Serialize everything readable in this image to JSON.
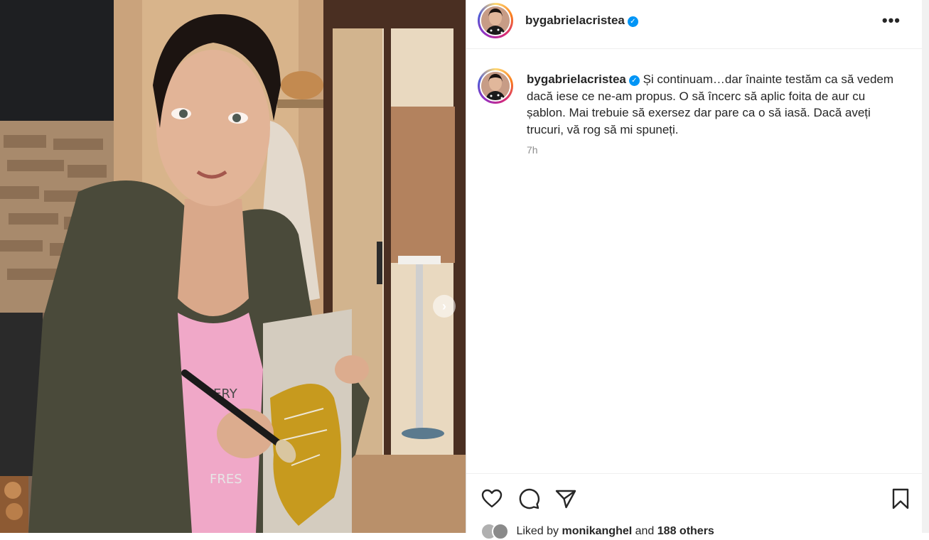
{
  "post": {
    "username": "bygabrielacristea",
    "caption": "Și continuam…dar înainte testăm ca să vedem dacă iese ce ne-am propus. O să încerc să aplic foita de aur cu șablon. Mai trebuie să exersez dar pare ca o să iasă. Dacă aveți trucuri, vă rog să mi spuneți.",
    "time_ago": "7h",
    "more_label": "•••"
  },
  "likes": {
    "prefix": "Liked by ",
    "user": "monikangheI",
    "connector": " and ",
    "others": "188 others"
  },
  "icons": {
    "like": "heart-icon",
    "comment": "comment-icon",
    "share": "send-icon",
    "save": "bookmark-icon",
    "verified": "verified-badge-icon",
    "next": "chevron-right-icon"
  },
  "colors": {
    "verified": "#0095f6",
    "secondary_text": "#8e8e8e"
  }
}
